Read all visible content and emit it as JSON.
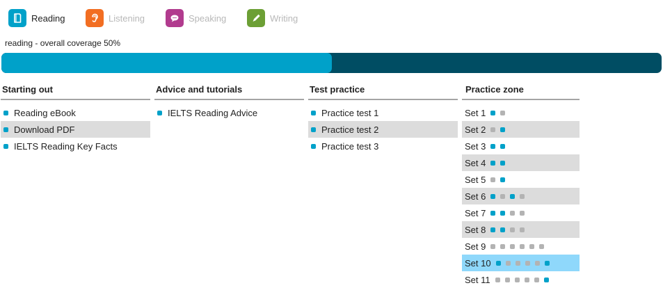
{
  "tabs": [
    {
      "label": "Reading",
      "icon": "book-icon",
      "color": "#00a1c9",
      "active": true
    },
    {
      "label": "Listening",
      "icon": "ear-icon",
      "color": "#f26e22",
      "active": false
    },
    {
      "label": "Speaking",
      "icon": "speech-bubble-icon",
      "color": "#b13b8e",
      "active": false
    },
    {
      "label": "Writing",
      "icon": "pencil-icon",
      "color": "#6c9f35",
      "active": false
    }
  ],
  "coverage": {
    "label": "reading - overall coverage 50%",
    "percent": 50,
    "fill_color": "#00a1c9",
    "track_color": "#004d63"
  },
  "columns": {
    "starting_out": {
      "title": "Starting out",
      "items": [
        {
          "label": "Reading eBook"
        },
        {
          "label": "Download PDF"
        },
        {
          "label": "IELTS Reading Key Facts"
        }
      ]
    },
    "advice": {
      "title": "Advice and tutorials",
      "items": [
        {
          "label": "IELTS Reading Advice"
        }
      ]
    },
    "test_practice": {
      "title": "Test practice",
      "items": [
        {
          "label": "Practice test 1"
        },
        {
          "label": "Practice test 2"
        },
        {
          "label": "Practice test 3"
        }
      ]
    },
    "practice_zone": {
      "title": "Practice zone",
      "sets": [
        {
          "label": "Set 1",
          "dots": [
            1,
            0
          ]
        },
        {
          "label": "Set 2",
          "dots": [
            0,
            1
          ]
        },
        {
          "label": "Set 3",
          "dots": [
            1,
            1
          ]
        },
        {
          "label": "Set 4",
          "dots": [
            1,
            1
          ]
        },
        {
          "label": "Set 5",
          "dots": [
            0,
            1
          ]
        },
        {
          "label": "Set 6",
          "dots": [
            1,
            0,
            1,
            0
          ]
        },
        {
          "label": "Set 7",
          "dots": [
            1,
            1,
            0,
            0
          ]
        },
        {
          "label": "Set 8",
          "dots": [
            1,
            1,
            0,
            0
          ]
        },
        {
          "label": "Set 9",
          "dots": [
            0,
            0,
            0,
            0,
            0,
            0
          ]
        },
        {
          "label": "Set 10",
          "dots": [
            1,
            0,
            0,
            0,
            0,
            1
          ],
          "selected": true
        },
        {
          "label": "Set 11",
          "dots": [
            0,
            0,
            0,
            0,
            0,
            1
          ]
        }
      ]
    }
  }
}
